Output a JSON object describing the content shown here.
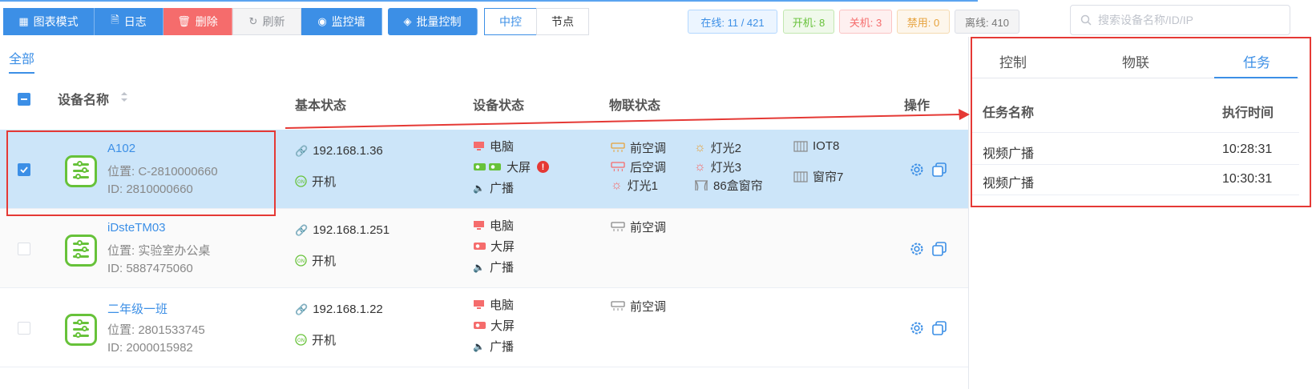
{
  "toolbar": {
    "chart_mode": "图表模式",
    "log": "日志",
    "delete": "删除",
    "refresh": "刷新",
    "monitor_wall": "监控墙",
    "batch_control": "批量控制",
    "central_control": "中控",
    "node": "节点"
  },
  "stats": {
    "online": "在线: 11 / 421",
    "on": "开机: 8",
    "off": "关机: 3",
    "disabled": "禁用: 0",
    "offline": "离线: 410"
  },
  "search": {
    "placeholder": "搜索设备名称/ID/IP"
  },
  "tabs": {
    "all": "全部"
  },
  "table": {
    "headers": {
      "name": "设备名称",
      "basic": "基本状态",
      "device": "设备状态",
      "iot": "物联状态",
      "ops": "操作"
    },
    "rows": [
      {
        "name": "A102",
        "location": "位置: C-2810000660",
        "id": "ID: 2810000660",
        "ip": "192.168.1.36",
        "power": "开机",
        "pc": "电脑",
        "screen": "大屏",
        "broadcast": "广播",
        "iot": {
          "col1": [
            "前空调",
            "后空调",
            "灯光1"
          ],
          "col2": [
            "灯光2",
            "灯光3",
            "86盒窗帘"
          ],
          "col3": [
            "IOT8",
            "窗帘7"
          ]
        }
      },
      {
        "name": "iDsteTM03",
        "location": "位置: 实验室办公桌",
        "id": "ID: 5887475060",
        "ip": "192.168.1.251",
        "power": "开机",
        "pc": "电脑",
        "screen": "大屏",
        "broadcast": "广播",
        "iot": {
          "col1": [
            "前空调"
          ]
        }
      },
      {
        "name": "二年级一班",
        "location": "位置: 2801533745",
        "id": "ID: 2000015982",
        "ip": "192.168.1.22",
        "power": "开机",
        "pc": "电脑",
        "screen": "大屏",
        "broadcast": "广播",
        "iot": {
          "col1": [
            "前空调"
          ]
        }
      }
    ]
  },
  "right_panel": {
    "tabs": [
      "控制",
      "物联",
      "任务"
    ],
    "active_tab": "任务",
    "headers": {
      "task": "任务名称",
      "time": "执行时间"
    },
    "tasks": [
      {
        "name": "视频广播",
        "time": "10:28:31"
      },
      {
        "name": "视频广播",
        "time": "10:30:31"
      }
    ]
  },
  "colors": {
    "accent": "#3c8fe6",
    "danger": "#f56c6c",
    "success": "#67c23a",
    "warning": "#e6a23c",
    "highlight": "#e53935"
  }
}
